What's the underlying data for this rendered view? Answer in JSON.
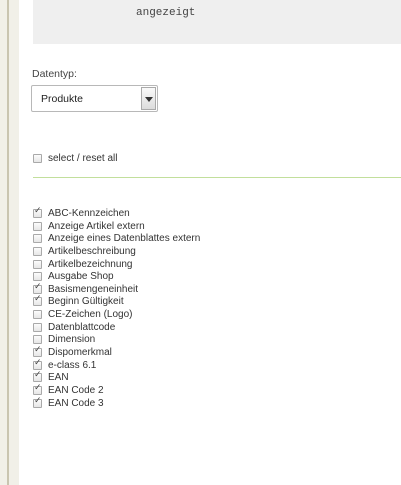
{
  "code_block": {
    "text": "angezeigt"
  },
  "datatype": {
    "label": "Datentyp:",
    "selected": "Produkte"
  },
  "select_all": {
    "label": "select / reset all",
    "checked": false
  },
  "fields": [
    {
      "label": "ABC-Kennzeichen",
      "checked": true
    },
    {
      "label": "Anzeige Artikel extern",
      "checked": false
    },
    {
      "label": "Anzeige eines Datenblattes extern",
      "checked": false
    },
    {
      "label": "Artikelbeschreibung",
      "checked": false
    },
    {
      "label": "Artikelbezeichnung",
      "checked": false
    },
    {
      "label": "Ausgabe Shop",
      "checked": false
    },
    {
      "label": "Basismengeneinheit",
      "checked": true
    },
    {
      "label": "Beginn Gültigkeit",
      "checked": true
    },
    {
      "label": "CE-Zeichen (Logo)",
      "checked": false
    },
    {
      "label": "Datenblattcode",
      "checked": false
    },
    {
      "label": "Dimension",
      "checked": false
    },
    {
      "label": "Dispomerkmal",
      "checked": true
    },
    {
      "label": "e-class 6.1",
      "checked": true
    },
    {
      "label": "EAN",
      "checked": true
    },
    {
      "label": "EAN Code 2",
      "checked": true
    },
    {
      "label": "EAN Code 3",
      "checked": true
    }
  ]
}
